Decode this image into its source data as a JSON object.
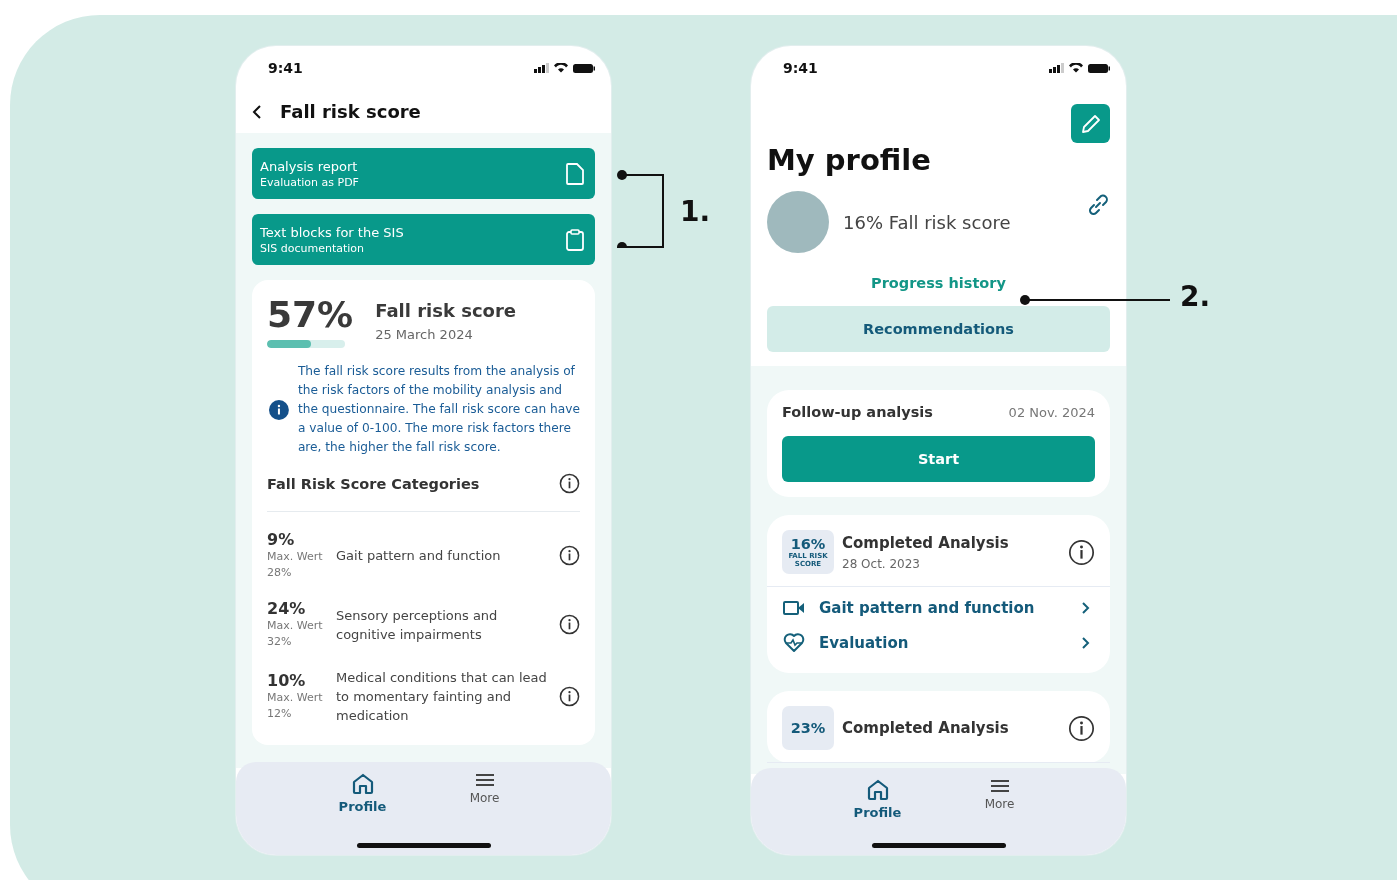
{
  "fall_risk_screen": {
    "status_time": "9:41",
    "title": "Fall risk score",
    "actions": [
      {
        "title": "Analysis report",
        "subtitle": "Evaluation as PDF",
        "kind": "pdf"
      },
      {
        "title": "Text blocks for the SIS",
        "subtitle": "SIS documentation",
        "kind": "clipboard"
      }
    ],
    "score": {
      "value": "57%",
      "level": 0.57,
      "title": "Fall risk score",
      "date": "25 March 2024"
    },
    "info_text": "The fall risk score results from the analysis of the risk factors of the mobility analysis and the questionnaire. The fall risk score can have a value of 0-100. The more risk factors there are, the higher the fall risk score.",
    "categories_title": "Fall Risk Score Categories",
    "categories": [
      {
        "value": "9%",
        "max_label": "Max. Wert",
        "max_value": "28%",
        "description": "Gait pattern and function"
      },
      {
        "value": "24%",
        "max_label": "Max. Wert",
        "max_value": "32%",
        "description": "Sensory perceptions and cognitive impairments"
      },
      {
        "value": "10%",
        "max_label": "Max. Wert",
        "max_value": "12%",
        "description": "Medical conditions that can lead to momentary fainting and medication"
      }
    ],
    "nav": [
      {
        "label": "Profile",
        "kind": "home",
        "selected": true
      },
      {
        "label": "More",
        "kind": "menu",
        "selected": false
      }
    ]
  },
  "profile_screen": {
    "status_time": "9:41",
    "title": "My profile",
    "score_text": "16% Fall risk score",
    "progress_link": "Progress history",
    "recommendations_button": "Recommendations",
    "follow_up": {
      "title": "Follow-up analysis",
      "date": "02 Nov. 2024",
      "button": "Start"
    },
    "analyses": [
      {
        "score": "16%",
        "score_caption": "FALL RISK SCORE",
        "title": "Completed Analysis",
        "date": "28 Oct. 2023",
        "links": [
          {
            "label": "Gait pattern and function",
            "kind": "video"
          },
          {
            "label": "Evaluation",
            "kind": "heart"
          }
        ]
      },
      {
        "score": "23%",
        "title": "Completed Analysis"
      }
    ],
    "nav": [
      {
        "label": "Profile",
        "kind": "home",
        "selected": true
      },
      {
        "label": "More",
        "kind": "menu",
        "selected": false
      }
    ]
  },
  "annotations": [
    "1.",
    "2."
  ]
}
